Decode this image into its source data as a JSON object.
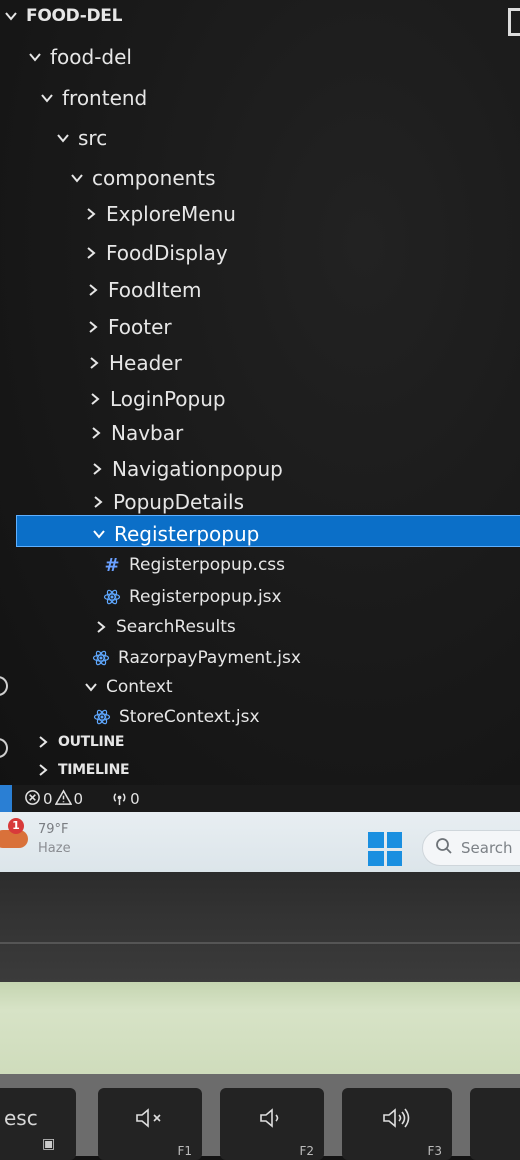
{
  "explorer": {
    "workspace_title": "FOOD-DEL",
    "tree": [
      {
        "label": "food-del",
        "expanded": true
      },
      {
        "label": "frontend",
        "expanded": true
      },
      {
        "label": "src",
        "expanded": true
      },
      {
        "label": "components",
        "expanded": true
      },
      {
        "label": "ExploreMenu",
        "expanded": false
      },
      {
        "label": "FoodDisplay",
        "expanded": false
      },
      {
        "label": "FoodItem",
        "expanded": false
      },
      {
        "label": "Footer",
        "expanded": false
      },
      {
        "label": "Header",
        "expanded": false
      },
      {
        "label": "LoginPopup",
        "expanded": false
      },
      {
        "label": "Navbar",
        "expanded": false
      },
      {
        "label": "Navigationpopup",
        "expanded": false
      },
      {
        "label": "PopupDetails",
        "expanded": false
      },
      {
        "label": "Registerpopup",
        "expanded": true,
        "selected": true
      },
      {
        "label": "Registerpopup.css",
        "icon": "css-hash-icon"
      },
      {
        "label": "Registerpopup.jsx",
        "icon": "react-icon"
      },
      {
        "label": "SearchResults",
        "expanded": false
      },
      {
        "label": "RazorpayPayment.jsx",
        "icon": "react-icon"
      },
      {
        "label": "Context",
        "expanded": true
      },
      {
        "label": "StoreContext.jsx",
        "icon": "react-icon"
      }
    ],
    "sections": {
      "outline": "OUTLINE",
      "timeline": "TIMELINE"
    },
    "selection_color": "#0b6fc8"
  },
  "status_bar": {
    "errors": "0",
    "warnings": "0",
    "ports": "0"
  },
  "taskbar": {
    "weather_badge": "1",
    "temperature": "79°F",
    "condition": "Haze",
    "search_placeholder": "Search"
  },
  "keyboard": {
    "esc_label": "esc",
    "f1_label": "F1",
    "f2_label": "F2",
    "f3_label": "F3"
  }
}
